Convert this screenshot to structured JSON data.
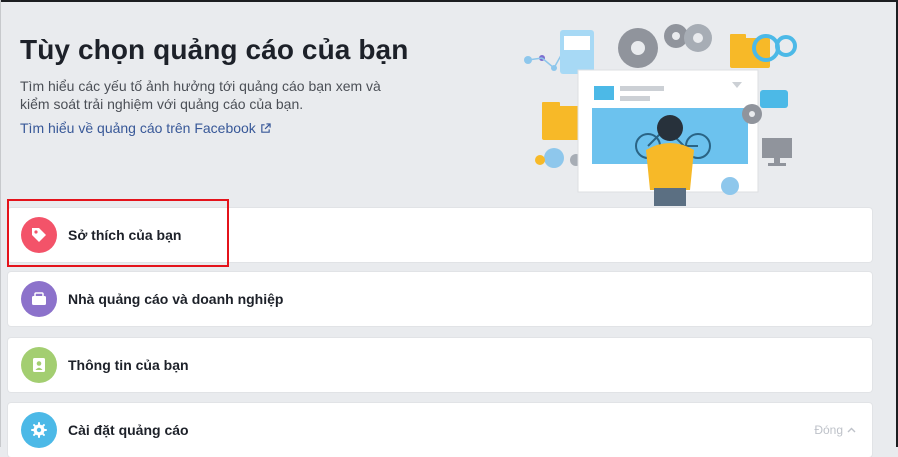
{
  "header": {
    "title": "Tùy chọn quảng cáo của bạn",
    "description": "Tìm hiểu các yếu tố ảnh hưởng tới quảng cáo bạn xem và kiểm soát trải nghiệm với quảng cáo của bạn.",
    "learn_link": "Tìm hiểu về quảng cáo trên Facebook"
  },
  "sections": [
    {
      "label": "Sở thích của bạn",
      "icon": "tag-icon",
      "color": "#f35369"
    },
    {
      "label": "Nhà quảng cáo và doanh nghiệp",
      "icon": "briefcase-icon",
      "color": "#8c72cb"
    },
    {
      "label": "Thông tin của bạn",
      "icon": "profile-card-icon",
      "color": "#a3ce71"
    },
    {
      "label": "Cài đặt quảng cáo",
      "icon": "gear-icon",
      "color": "#4cb9e7",
      "right_label": "Đóng"
    }
  ],
  "colors": {
    "background": "#e9ebee",
    "link": "#385898",
    "highlight_box": "#e4131b"
  }
}
